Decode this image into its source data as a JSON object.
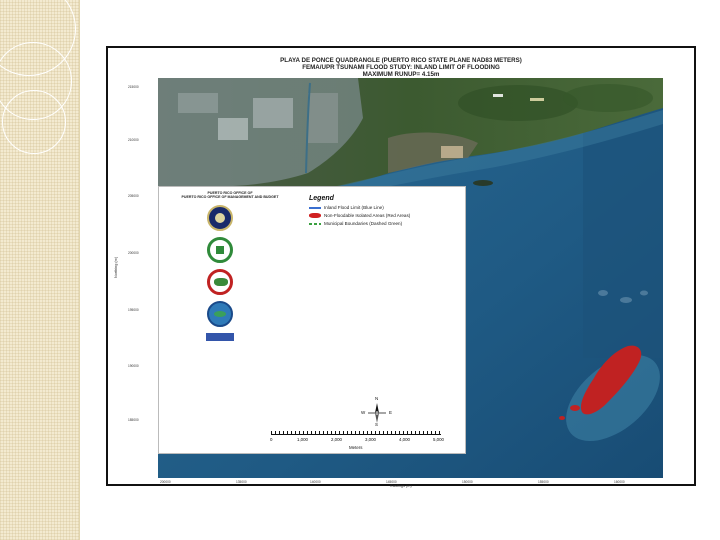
{
  "map": {
    "title_lines": [
      "PLAYA DE PONCE QUADRANGLE (PUERTO RICO STATE PLANE NAD83 METERS)",
      "FEMA/UPR TSUNAMI FLOOD STUDY: INLAND LIMIT OF FLOODING",
      "MAXIMUM RUNUP= 4.15m"
    ],
    "y_ticks": [
      "215000",
      "210000",
      "205000",
      "200000",
      "195000",
      "190000",
      "185000"
    ],
    "y_label": "Northing (m)",
    "x_ticks": [
      "200000",
      "135000",
      "140000",
      "145000",
      "150000",
      "155000",
      "160000",
      "165000",
      "170000",
      "175000"
    ],
    "x_label": "Eastings (m)",
    "agency_lines": [
      "PUERTO RICO OFFICE OF",
      "PUERTO RICO OFFICE OF MANAGEMENT AND BUDGET"
    ],
    "legend": {
      "title": "Legend",
      "items": [
        {
          "label": "Inland Flood Limit (Blue Line)",
          "color": "#3a6fd0"
        },
        {
          "label": "Non-Floodable Isolated Areas (Red Areas)",
          "color": "#d02020"
        },
        {
          "label": "Municipal Boundaries (Dashed Green)",
          "color": "#3aa040"
        }
      ]
    },
    "north": {
      "n": "N",
      "s": "S",
      "e": "E",
      "w": "W"
    },
    "scale": {
      "labels": [
        "0",
        "1,000",
        "2,000",
        "3,000",
        "4,000",
        "5,000"
      ],
      "unit": "Meters"
    },
    "colors": {
      "ocean": "#1f5d86",
      "land": "#3f5f34",
      "flood_area": "#d02020"
    }
  }
}
